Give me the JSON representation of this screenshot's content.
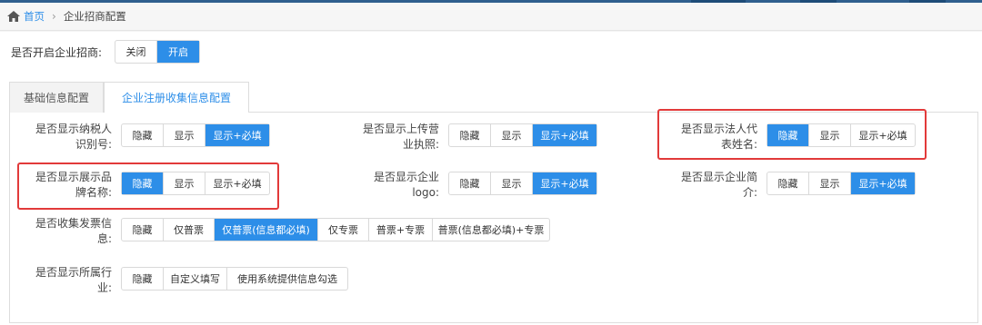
{
  "breadcrumb": {
    "home": "首页",
    "separator": "›",
    "current": "企业招商配置"
  },
  "open_setting": {
    "label": "是否开启企业招商:",
    "options": [
      "关闭",
      "开启"
    ],
    "selected": 1
  },
  "tabs": [
    {
      "label": "基础信息配置",
      "active": false
    },
    {
      "label": "企业注册收集信息配置",
      "active": true
    }
  ],
  "fields": {
    "taxpayer_id": {
      "label_line1": "是否显示纳税人",
      "label_line2": "识别号:",
      "options": [
        "隐藏",
        "显示",
        "显示+必填"
      ],
      "selected": 2
    },
    "business_license": {
      "label_line1": "是否显示上传营",
      "label_line2": "业执照:",
      "options": [
        "隐藏",
        "显示",
        "显示+必填"
      ],
      "selected": 2
    },
    "legal_rep": {
      "label_line1": "是否显示法人代",
      "label_line2": "表姓名:",
      "options": [
        "隐藏",
        "显示",
        "显示+必填"
      ],
      "selected": 0
    },
    "brand_name": {
      "label_line1": "是否显示展示品",
      "label_line2": "牌名称:",
      "options": [
        "隐藏",
        "显示",
        "显示+必填"
      ],
      "selected": 0
    },
    "company_logo": {
      "label_line1": "是否显示企业",
      "label_line2": "logo:",
      "options": [
        "隐藏",
        "显示",
        "显示+必填"
      ],
      "selected": 2
    },
    "company_intro": {
      "label_line1": "是否显示企业简",
      "label_line2": "介:",
      "options": [
        "隐藏",
        "显示",
        "显示+必填"
      ],
      "selected": 2
    },
    "invoice": {
      "label_line1": "是否收集发票信",
      "label_line2": "息:",
      "options": [
        "隐藏",
        "仅普票",
        "仅普票(信息都必填)",
        "仅专票",
        "普票+专票",
        "普票(信息都必填)+专票"
      ],
      "selected": 2
    },
    "industry": {
      "label_line1": "是否显示所属行",
      "label_line2": "业:",
      "options": [
        "隐藏",
        "自定义填写",
        "使用系统提供信息勾选"
      ],
      "selected": 0
    }
  },
  "colors": {
    "accent": "#2d8ee8",
    "highlight_box": "#e23a3a",
    "top_bar": "#2f5f8e"
  }
}
